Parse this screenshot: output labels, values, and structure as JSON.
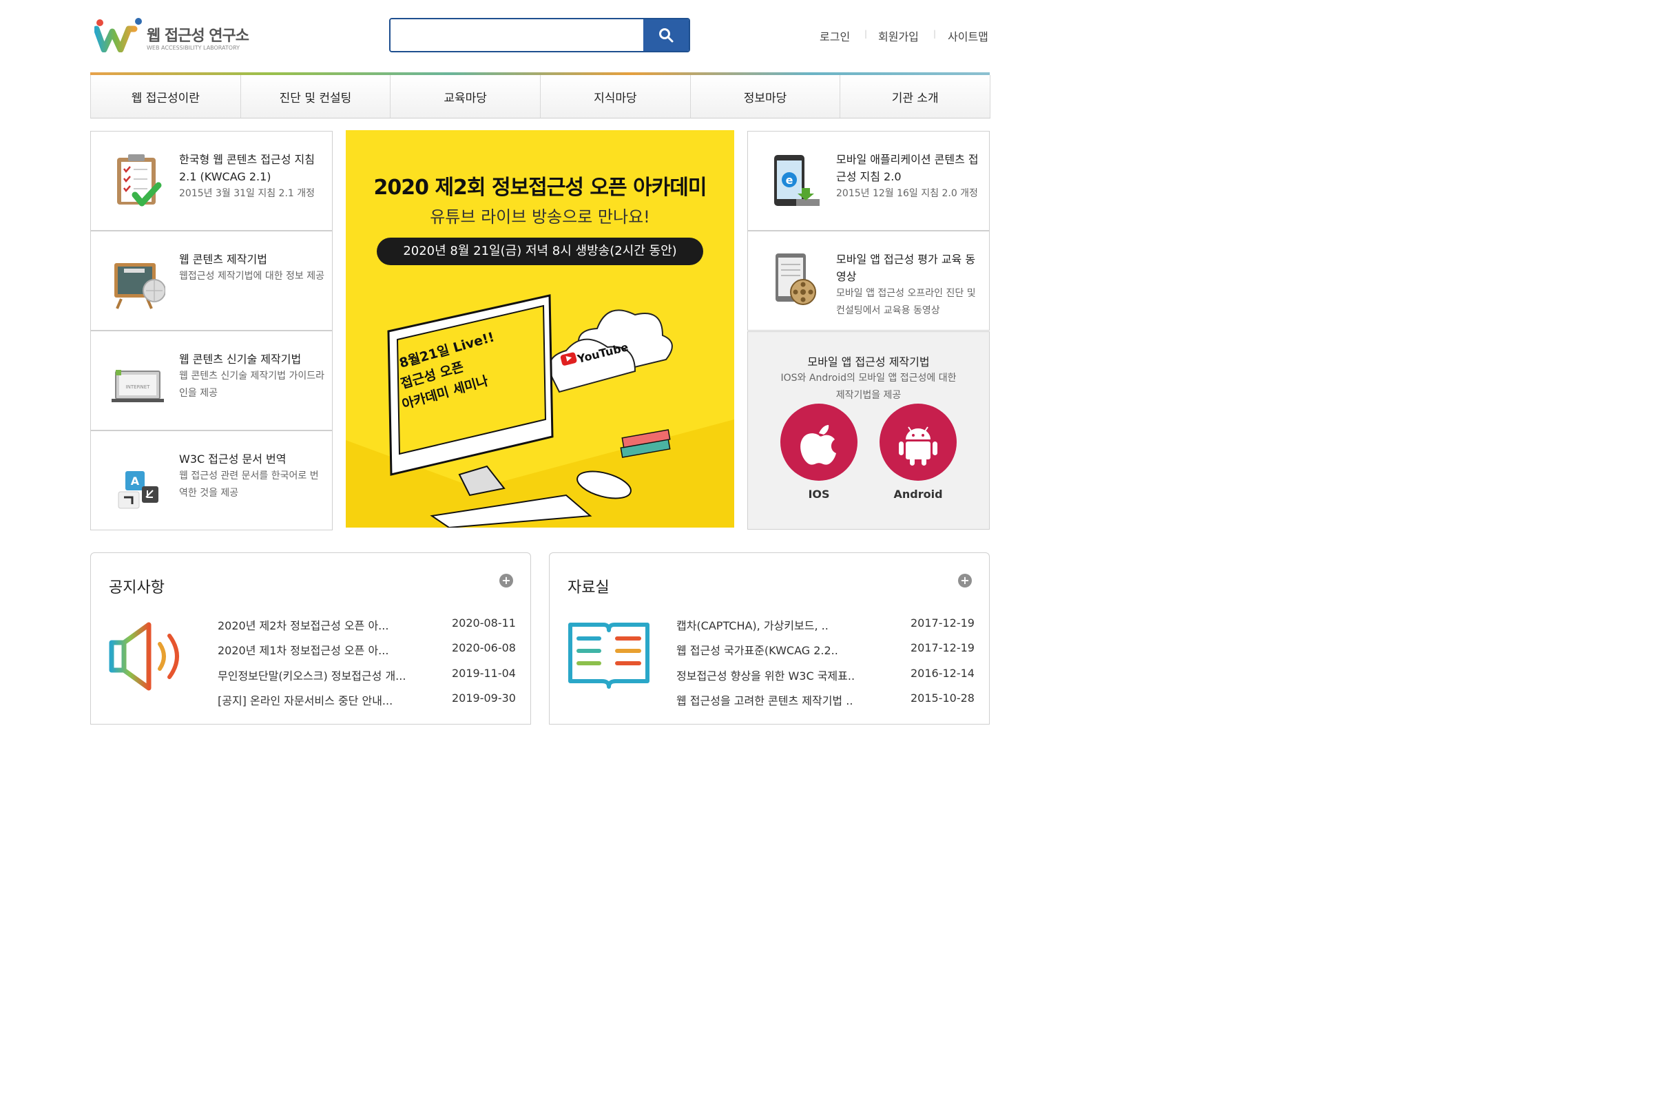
{
  "header": {
    "logo_title": "웹 접근성 연구소",
    "logo_sub": "WEB ACCESSIBILITY LABORATORY",
    "search_placeholder": "",
    "util": [
      "로그인",
      "회원가입",
      "사이트맵"
    ]
  },
  "nav": [
    "웹 접근성이란",
    "진단 및 컨설팅",
    "교육마당",
    "지식마당",
    "정보마당",
    "기관 소개"
  ],
  "left_cards": [
    {
      "title": "한국형 웹 콘텐츠 접근성 지침 2.1 (KWCAG 2.1)",
      "desc": "2015년 3월 31일 지침 2.1 개정",
      "icon": "checklist-clipboard-icon"
    },
    {
      "title": "웹 콘텐츠 제작기법",
      "desc": "웹접근성 제작기법에 대한 정보 제공",
      "icon": "blackboard-globe-icon"
    },
    {
      "title": "웹 콘텐츠 신기술 제작기법",
      "desc": "웹 콘텐츠 신기술 제작기법 가이드라인을 제공",
      "icon": "laptop-internet-icon"
    },
    {
      "title": "W3C 접근성 문서 번역",
      "desc": "웹 접근성 관련 문서를 한국어로 번역한 것을 제공",
      "icon": "translate-blocks-icon"
    }
  ],
  "banner": {
    "title": "2020 제2회 정보접근성 오픈 아카데미",
    "subtitle": "유튜브 라이브 방송으로 만나요!",
    "date_pill": "2020년 8월 21일(금) 저녁 8시 생방송(2시간 동안)",
    "screen_text": [
      "8월21일 Live!!",
      "접근성 오픈",
      "아카데미 세미나"
    ],
    "youtube_label": "YouTube",
    "bg_color": "#fde020"
  },
  "right_cards": [
    {
      "title": "모바일 애플리케이션 콘텐츠 접근성 지침 2.0",
      "desc": "2015년 12월 16일 지침 2.0 개정",
      "icon": "mobile-ie-icon"
    },
    {
      "title": "모바일 앱 접근성 평가 교육 동영상",
      "desc": "모바일 앱 접근성 오프라인 진단 및 컨설팅에서 교육용 동영상",
      "icon": "tablet-film-reel-icon"
    }
  ],
  "mobile_box": {
    "title": "모바일 앱 접근성 제작기법",
    "desc_line1": "IOS와 Android의 모바일 앱 접근성에 대한",
    "desc_line2": "제작기법을 제공",
    "ios_label": "IOS",
    "android_label": "Android",
    "circle_color": "#c71f4d"
  },
  "notice": {
    "title": "공지사항",
    "more_label": "+",
    "items": [
      {
        "title": "2020년 제2차 정보접근성 오픈 아...",
        "date": "2020-08-11"
      },
      {
        "title": "2020년 제1차 정보접근성 오픈 아...",
        "date": "2020-06-08"
      },
      {
        "title": "무인정보단말(키오스크) 정보접근성 개...",
        "date": "2019-11-04"
      },
      {
        "title": "[공지] 온라인 자문서비스 중단 안내...",
        "date": "2019-09-30"
      }
    ]
  },
  "archive": {
    "title": "자료실",
    "more_label": "+",
    "items": [
      {
        "title": "캡차(CAPTCHA), 가상키보드, ..",
        "date": "2017-12-19"
      },
      {
        "title": "웹 접근성 국가표준(KWCAG 2.2..",
        "date": "2017-12-19"
      },
      {
        "title": "정보접근성 향상을 위한 W3C 국제표..",
        "date": "2016-12-14"
      },
      {
        "title": "웹 접근성을 고려한 콘텐츠 제작기법 ..",
        "date": "2015-10-28"
      }
    ]
  }
}
